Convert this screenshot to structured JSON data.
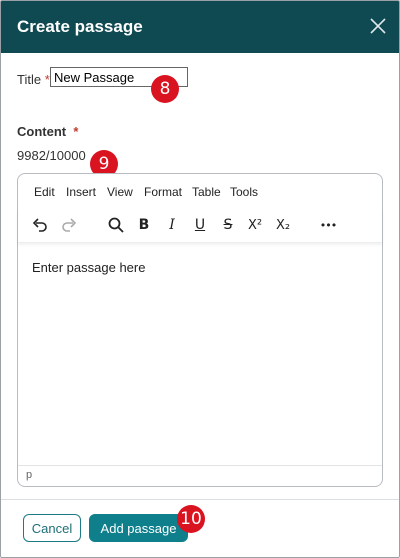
{
  "dialog": {
    "title": "Create passage",
    "close_icon": "close-icon"
  },
  "title_field": {
    "label": "Title",
    "required_mark": "*",
    "value": "New Passage"
  },
  "content_field": {
    "label": "Content",
    "required_mark": "*",
    "char_count": "9982/10000"
  },
  "editor": {
    "menu": [
      "Edit",
      "Insert",
      "View",
      "Format",
      "Table",
      "Tools"
    ],
    "toolbar": {
      "undo": "undo-icon",
      "redo": "redo-icon",
      "find": "search-icon",
      "bold": "B",
      "italic": "I",
      "underline": "U",
      "strikethrough": "S",
      "superscript": "X²",
      "subscript": "X₂",
      "more": "•••"
    },
    "placeholder": "Enter passage here",
    "status_path": "p"
  },
  "footer": {
    "cancel_label": "Cancel",
    "add_label": "Add passage"
  },
  "annotations": [
    "8",
    "9",
    "10"
  ],
  "colors": {
    "header": "#0f4a52",
    "primary_button": "#0f7f8c",
    "badge": "#d9131f"
  }
}
